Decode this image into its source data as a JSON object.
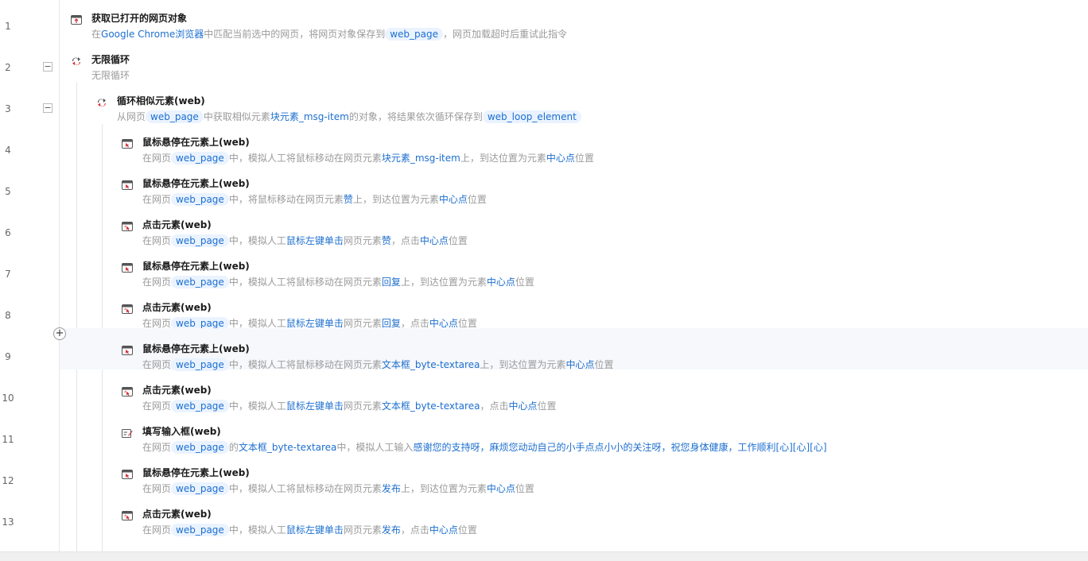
{
  "rows": [
    {
      "num": "1",
      "title": "获取已打开的网页对象",
      "icon": "browser-open-icon",
      "desc": [
        [
          "t",
          "在"
        ],
        [
          "h",
          "Google Chrome浏览器"
        ],
        [
          "t",
          "中匹配当前选中的网页，将网页对象保存到"
        ],
        [
          "v",
          "web_page"
        ],
        [
          "t",
          "，网页加载超时后重试此指令"
        ]
      ]
    },
    {
      "num": "2",
      "title": "无限循环",
      "icon": "loop-icon",
      "collapse": "−",
      "desc": [
        [
          "t",
          "无限循环"
        ]
      ]
    },
    {
      "num": "3",
      "title": "循环相似元素(web)",
      "icon": "loop-element-icon",
      "collapse": "−",
      "desc": [
        [
          "t",
          "从网页"
        ],
        [
          "v",
          "web_page"
        ],
        [
          "t",
          "中获取相似元素"
        ],
        [
          "h",
          "块元素_msg-item"
        ],
        [
          "t",
          "的对象，将结果依次循环保存到"
        ],
        [
          "v",
          "web_loop_element"
        ]
      ]
    },
    {
      "num": "4",
      "title": "鼠标悬停在元素上(web)",
      "icon": "mouse-hover-icon",
      "desc": [
        [
          "t",
          "在网页"
        ],
        [
          "v",
          "web_page"
        ],
        [
          "t",
          "中，模拟人工将鼠标移动在网页元素"
        ],
        [
          "h",
          "块元素_msg-item"
        ],
        [
          "t",
          "上，到达位置为元素"
        ],
        [
          "h",
          "中心点"
        ],
        [
          "t",
          "位置"
        ]
      ]
    },
    {
      "num": "5",
      "title": "鼠标悬停在元素上(web)",
      "icon": "mouse-hover-icon",
      "desc": [
        [
          "t",
          "在网页"
        ],
        [
          "v",
          "web_page"
        ],
        [
          "t",
          "中，将鼠标移动在网页元素"
        ],
        [
          "h",
          "赞"
        ],
        [
          "t",
          "上，到达位置为元素"
        ],
        [
          "h",
          "中心点"
        ],
        [
          "t",
          "位置"
        ]
      ]
    },
    {
      "num": "6",
      "title": "点击元素(web)",
      "icon": "click-element-icon",
      "desc": [
        [
          "t",
          "在网页"
        ],
        [
          "v",
          "web_page"
        ],
        [
          "t",
          "中，模拟人工"
        ],
        [
          "h",
          "鼠标左键单击"
        ],
        [
          "t",
          "网页元素"
        ],
        [
          "h",
          "赞"
        ],
        [
          "t",
          "，点击"
        ],
        [
          "h",
          "中心点"
        ],
        [
          "t",
          "位置"
        ]
      ]
    },
    {
      "num": "7",
      "title": "鼠标悬停在元素上(web)",
      "icon": "mouse-hover-icon",
      "desc": [
        [
          "t",
          "在网页"
        ],
        [
          "v",
          "web_page"
        ],
        [
          "t",
          "中，模拟人工将鼠标移动在网页元素"
        ],
        [
          "h",
          "回复"
        ],
        [
          "t",
          "上，到达位置为元素"
        ],
        [
          "h",
          "中心点"
        ],
        [
          "t",
          "位置"
        ]
      ]
    },
    {
      "num": "8",
      "title": "点击元素(web)",
      "icon": "click-element-icon",
      "desc": [
        [
          "t",
          "在网页"
        ],
        [
          "v",
          "web_page"
        ],
        [
          "t",
          "中，模拟人工"
        ],
        [
          "h",
          "鼠标左键单击"
        ],
        [
          "t",
          "网页元素"
        ],
        [
          "h",
          "回复"
        ],
        [
          "t",
          "，点击"
        ],
        [
          "h",
          "中心点"
        ],
        [
          "t",
          "位置"
        ]
      ]
    },
    {
      "num": "9",
      "title": "鼠标悬停在元素上(web)",
      "icon": "mouse-hover-icon",
      "highlight": true,
      "desc": [
        [
          "t",
          "在网页"
        ],
        [
          "v",
          "web_page"
        ],
        [
          "t",
          "中，模拟人工将鼠标移动在网页元素"
        ],
        [
          "h",
          "文本框_byte-textarea"
        ],
        [
          "t",
          "上，到达位置为元素"
        ],
        [
          "h",
          "中心点"
        ],
        [
          "t",
          "位置"
        ]
      ]
    },
    {
      "num": "10",
      "title": "点击元素(web)",
      "icon": "click-element-icon",
      "desc": [
        [
          "t",
          "在网页"
        ],
        [
          "v",
          "web_page"
        ],
        [
          "t",
          "中，模拟人工"
        ],
        [
          "h",
          "鼠标左键单击"
        ],
        [
          "t",
          "网页元素"
        ],
        [
          "h",
          "文本框_byte-textarea"
        ],
        [
          "t",
          "，点击"
        ],
        [
          "h",
          "中心点"
        ],
        [
          "t",
          "位置"
        ]
      ]
    },
    {
      "num": "11",
      "title": "填写输入框(web)",
      "icon": "fill-input-icon",
      "desc": [
        [
          "t",
          "在网页"
        ],
        [
          "v",
          "web_page"
        ],
        [
          "t",
          "的"
        ],
        [
          "h",
          "文本框_byte-textarea"
        ],
        [
          "t",
          "中，模拟人工输入"
        ],
        [
          "h",
          "感谢您的支持呀，麻烦您动动自己的小手点点小小的关注呀，祝您身体健康，工作顺利[心][心][心]"
        ]
      ]
    },
    {
      "num": "12",
      "title": "鼠标悬停在元素上(web)",
      "icon": "mouse-hover-icon",
      "desc": [
        [
          "t",
          "在网页"
        ],
        [
          "v",
          "web_page"
        ],
        [
          "t",
          "中，模拟人工将鼠标移动在网页元素"
        ],
        [
          "h",
          "发布"
        ],
        [
          "t",
          "上，到达位置为元素"
        ],
        [
          "h",
          "中心点"
        ],
        [
          "t",
          "位置"
        ]
      ]
    },
    {
      "num": "13",
      "title": "点击元素(web)",
      "icon": "click-element-icon",
      "desc": [
        [
          "t",
          "在网页"
        ],
        [
          "v",
          "web_page"
        ],
        [
          "t",
          "中，模拟人工"
        ],
        [
          "h",
          "鼠标左键单击"
        ],
        [
          "t",
          "网页元素"
        ],
        [
          "h",
          "发布"
        ],
        [
          "t",
          "，点击"
        ],
        [
          "h",
          "中心点"
        ],
        [
          "t",
          "位置"
        ]
      ]
    }
  ],
  "add_button_label": "+",
  "colors": {
    "accent": "#1d6fcf",
    "var_bg": "#eaf3ff",
    "highlight_row": "#f6f8fb",
    "icon_red": "#d0343a"
  }
}
